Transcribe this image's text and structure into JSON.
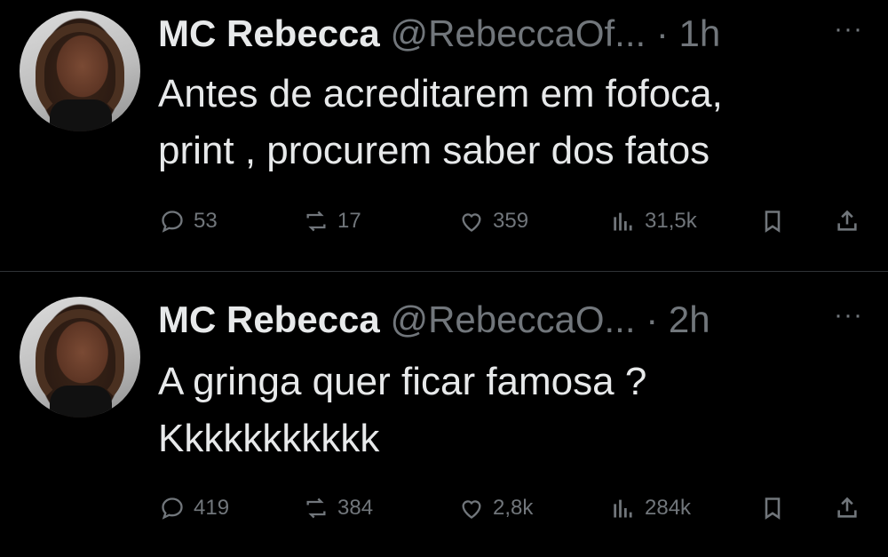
{
  "tweets": [
    {
      "name": "MC Rebecca",
      "handle": "@RebeccaOf...",
      "dot": "·",
      "time": "1h",
      "more": "···",
      "text_line1": "Antes de acreditarem em fofoca,",
      "text_line2": "print , procurem saber dos fatos",
      "replies": "53",
      "retweets": "17",
      "likes": "359",
      "views": "31,5k"
    },
    {
      "name": "MC Rebecca",
      "handle": "@RebeccaO...",
      "dot": "·",
      "time": "2h",
      "more": "···",
      "text_line1": "A gringa quer ficar famosa ?",
      "text_line2": "Kkkkkkkkkkk",
      "replies": "419",
      "retweets": "384",
      "likes": "2,8k",
      "views": "284k"
    }
  ],
  "icons": [
    "reply-icon",
    "retweet-icon",
    "like-icon",
    "views-icon",
    "bookmark-icon",
    "share-icon"
  ],
  "colors": {
    "background": "#000000",
    "text": "#e7e9ea",
    "muted": "#71767b",
    "divider": "#2f3336"
  }
}
